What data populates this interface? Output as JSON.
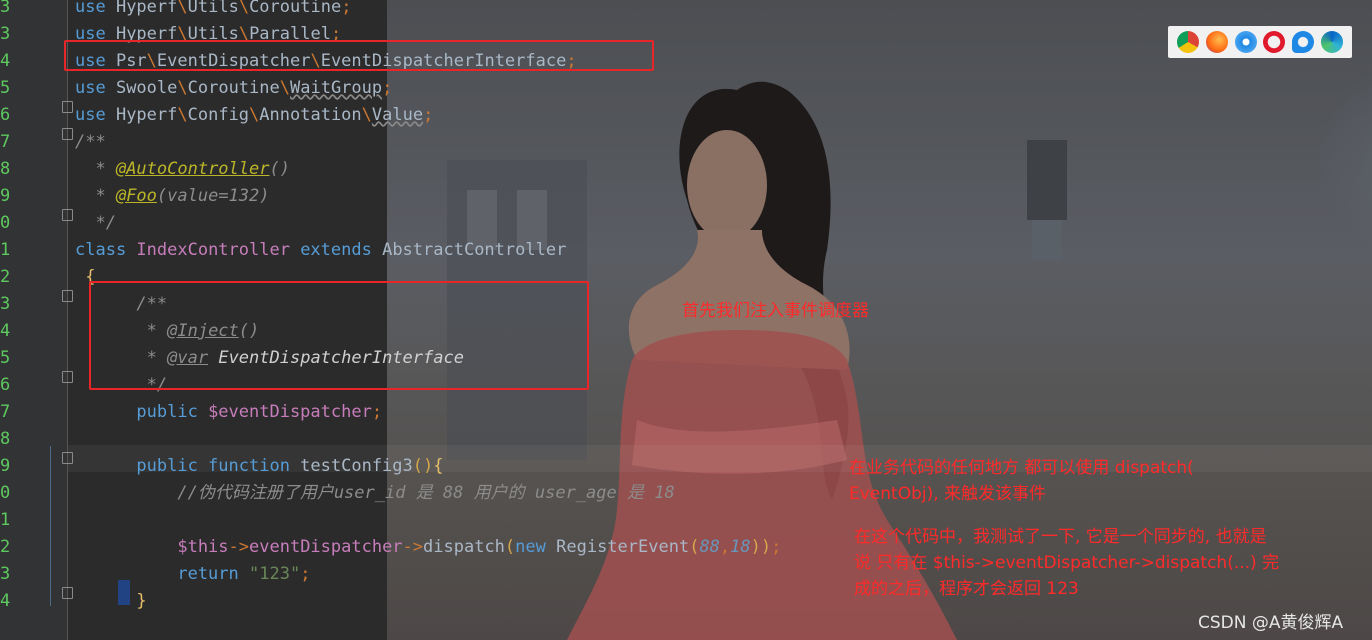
{
  "editor": {
    "lines": [
      {
        "num": "3",
        "parts": [
          [
            "kw",
            "use "
          ],
          [
            "cls",
            "Hyperf"
          ],
          [
            "bs",
            "\\"
          ],
          [
            "cls",
            "Utils"
          ],
          [
            "bs",
            "\\"
          ],
          [
            "cls",
            "Coroutine"
          ],
          [
            "semi",
            ";"
          ]
        ]
      },
      {
        "num": "3",
        "parts": [
          [
            "kw",
            "use "
          ],
          [
            "cls",
            "Hyperf"
          ],
          [
            "bs",
            "\\"
          ],
          [
            "cls",
            "Utils"
          ],
          [
            "bs",
            "\\"
          ],
          [
            "cls",
            "Parallel"
          ],
          [
            "semi",
            ";"
          ]
        ]
      },
      {
        "num": "4",
        "parts": [
          [
            "kw",
            "use "
          ],
          [
            "cls",
            "Psr"
          ],
          [
            "bs",
            "\\"
          ],
          [
            "cls",
            "EventDispatcher"
          ],
          [
            "bs",
            "\\"
          ],
          [
            "cls",
            "EventDispatcherInterface"
          ],
          [
            "semi",
            ";"
          ]
        ]
      },
      {
        "num": "5",
        "parts": [
          [
            "kw",
            "use "
          ],
          [
            "cls",
            "Swoole"
          ],
          [
            "bs",
            "\\"
          ],
          [
            "cls",
            "Coroutine"
          ],
          [
            "bs",
            "\\"
          ],
          [
            "ul",
            "WaitGroup"
          ],
          [
            "semi",
            ";"
          ]
        ]
      },
      {
        "num": "6",
        "parts": [
          [
            "kw",
            "use "
          ],
          [
            "cls",
            "Hyperf"
          ],
          [
            "bs",
            "\\"
          ],
          [
            "cls",
            "Config"
          ],
          [
            "bs",
            "\\"
          ],
          [
            "cls",
            "Annotation"
          ],
          [
            "bs",
            "\\"
          ],
          [
            "ul",
            "Value"
          ],
          [
            "semi",
            ";"
          ]
        ]
      },
      {
        "num": "7",
        "parts": [
          [
            "cm",
            "/**"
          ]
        ]
      },
      {
        "num": "8",
        "parts": [
          [
            "cm",
            "  * "
          ],
          [
            "ann",
            "@AutoController"
          ],
          [
            "cm",
            "()"
          ]
        ]
      },
      {
        "num": "9",
        "parts": [
          [
            "cm",
            "  * "
          ],
          [
            "ann",
            "@Foo"
          ],
          [
            "cm",
            "(value=132)"
          ]
        ]
      },
      {
        "num": "0",
        "parts": [
          [
            "cm",
            "  */"
          ]
        ]
      },
      {
        "num": "1",
        "parts": [
          [
            "kw",
            "class "
          ],
          [
            "purple",
            "IndexController "
          ],
          [
            "kw",
            "extends "
          ],
          [
            "cls",
            "AbstractController"
          ]
        ]
      },
      {
        "num": "2",
        "parts": [
          [
            "brace",
            " {"
          ]
        ]
      },
      {
        "num": "3",
        "parts": [
          [
            "cm",
            "      /**"
          ]
        ]
      },
      {
        "num": "4",
        "parts": [
          [
            "cm",
            "       * "
          ],
          [
            "cmt-tag",
            "@Inject"
          ],
          [
            "cm",
            "()"
          ]
        ]
      },
      {
        "num": "5",
        "parts": [
          [
            "cm",
            "       * "
          ],
          [
            "cmt-tag",
            "@var"
          ],
          [
            "cm",
            " "
          ],
          [
            "type-i",
            "EventDispatcherInterface"
          ]
        ]
      },
      {
        "num": "6",
        "parts": [
          [
            "cm",
            "       */"
          ]
        ]
      },
      {
        "num": "7",
        "parts": [
          [
            "kw",
            "      public "
          ],
          [
            "var",
            "$eventDispatcher"
          ],
          [
            "semi",
            ";"
          ]
        ]
      },
      {
        "num": "8",
        "parts": [
          [
            "cls",
            ""
          ]
        ]
      },
      {
        "num": "9",
        "parts": [
          [
            "kw",
            "      public function "
          ],
          [
            "cls",
            "testConfig3"
          ],
          [
            "paren",
            "()"
          ],
          [
            "brace",
            "{"
          ]
        ]
      },
      {
        "num": "0",
        "parts": [
          [
            "cm",
            "          //伪代码注册了用户user_id 是 88 用户的 user_age 是 18"
          ]
        ]
      },
      {
        "num": "1",
        "parts": [
          [
            "cls",
            ""
          ]
        ]
      },
      {
        "num": "2",
        "parts": [
          [
            "var",
            "          $this"
          ],
          [
            "semi",
            "->"
          ],
          [
            "var",
            "eventDispatcher"
          ],
          [
            "semi",
            "->"
          ],
          [
            "cls",
            "dispatch"
          ],
          [
            "paren",
            "("
          ],
          [
            "kw",
            "new "
          ],
          [
            "cls",
            "RegisterEvent"
          ],
          [
            "paren",
            "("
          ],
          [
            "num",
            "88"
          ],
          [
            "semi",
            ","
          ],
          [
            "num",
            "18"
          ],
          [
            "paren",
            "))"
          ],
          [
            "semi",
            ";"
          ]
        ]
      },
      {
        "num": "3",
        "parts": [
          [
            "kw",
            "          return "
          ],
          [
            "str",
            "\"123\""
          ],
          [
            "semi",
            ";"
          ]
        ]
      },
      {
        "num": "4",
        "parts": [
          [
            "brace",
            "      }"
          ]
        ]
      }
    ]
  },
  "annotations": {
    "note1": "首先我们注入事件调度器",
    "note2_line1": "在业务代码的任何地方 都可以使用 dispatch(",
    "note2_line2": "EventObj), 来触发该事件",
    "note3_line1": "在这个代码中，我测试了一下, 它是一个同步的, 也就是",
    "note3_line2": "说 只有在 $this->eventDispatcher->dispatch(...) 完",
    "note3_line3": "成的之后，程序才会返回 123"
  },
  "watermark": "CSDN @A黄俊辉A",
  "browser_icons": [
    "chrome-icon",
    "firefox-icon",
    "safari-icon",
    "opera-icon",
    "ie-icon",
    "edge-icon"
  ],
  "colors": {
    "annotation_red": "#e8262a",
    "line_number_green": "#5ec95e",
    "editor_bg": "#2b2b2b"
  }
}
